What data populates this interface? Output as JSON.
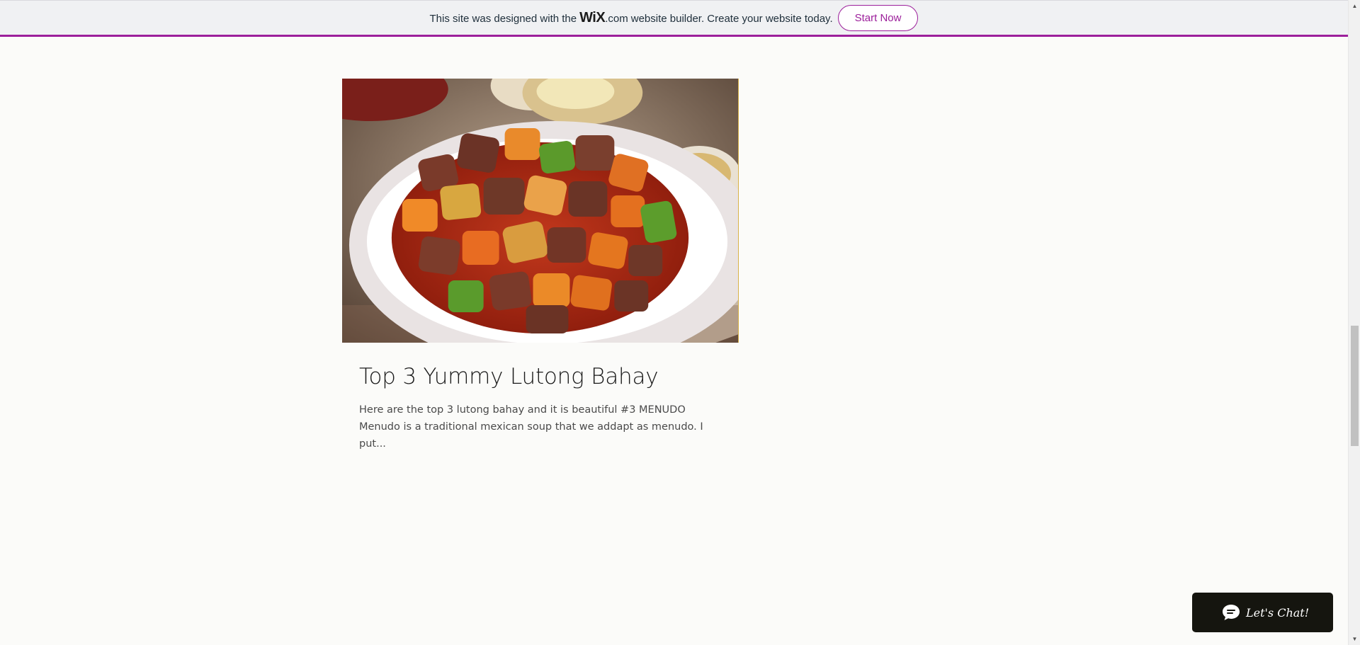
{
  "banner": {
    "text_before": "This site was designed with the",
    "wix_logo": "WiX",
    "wix_domain": ".com",
    "text_after": "website builder. Create your website today.",
    "button_label": "Start Now",
    "accent_color": "#9c1f9b"
  },
  "post": {
    "title": "Top 3 Yummy Lutong Bahay",
    "excerpt": "Here are the top 3 lutong bahay and it is beautiful #3 MENUDO Menudo is a traditional mexican soup that we addapt as menudo.     I put...",
    "image_description_icon": "food-photo"
  },
  "chat": {
    "label": "Let's Chat!",
    "icon": "chat-bubble-icon"
  },
  "scrollbar": {
    "position_fraction": 0.56
  }
}
